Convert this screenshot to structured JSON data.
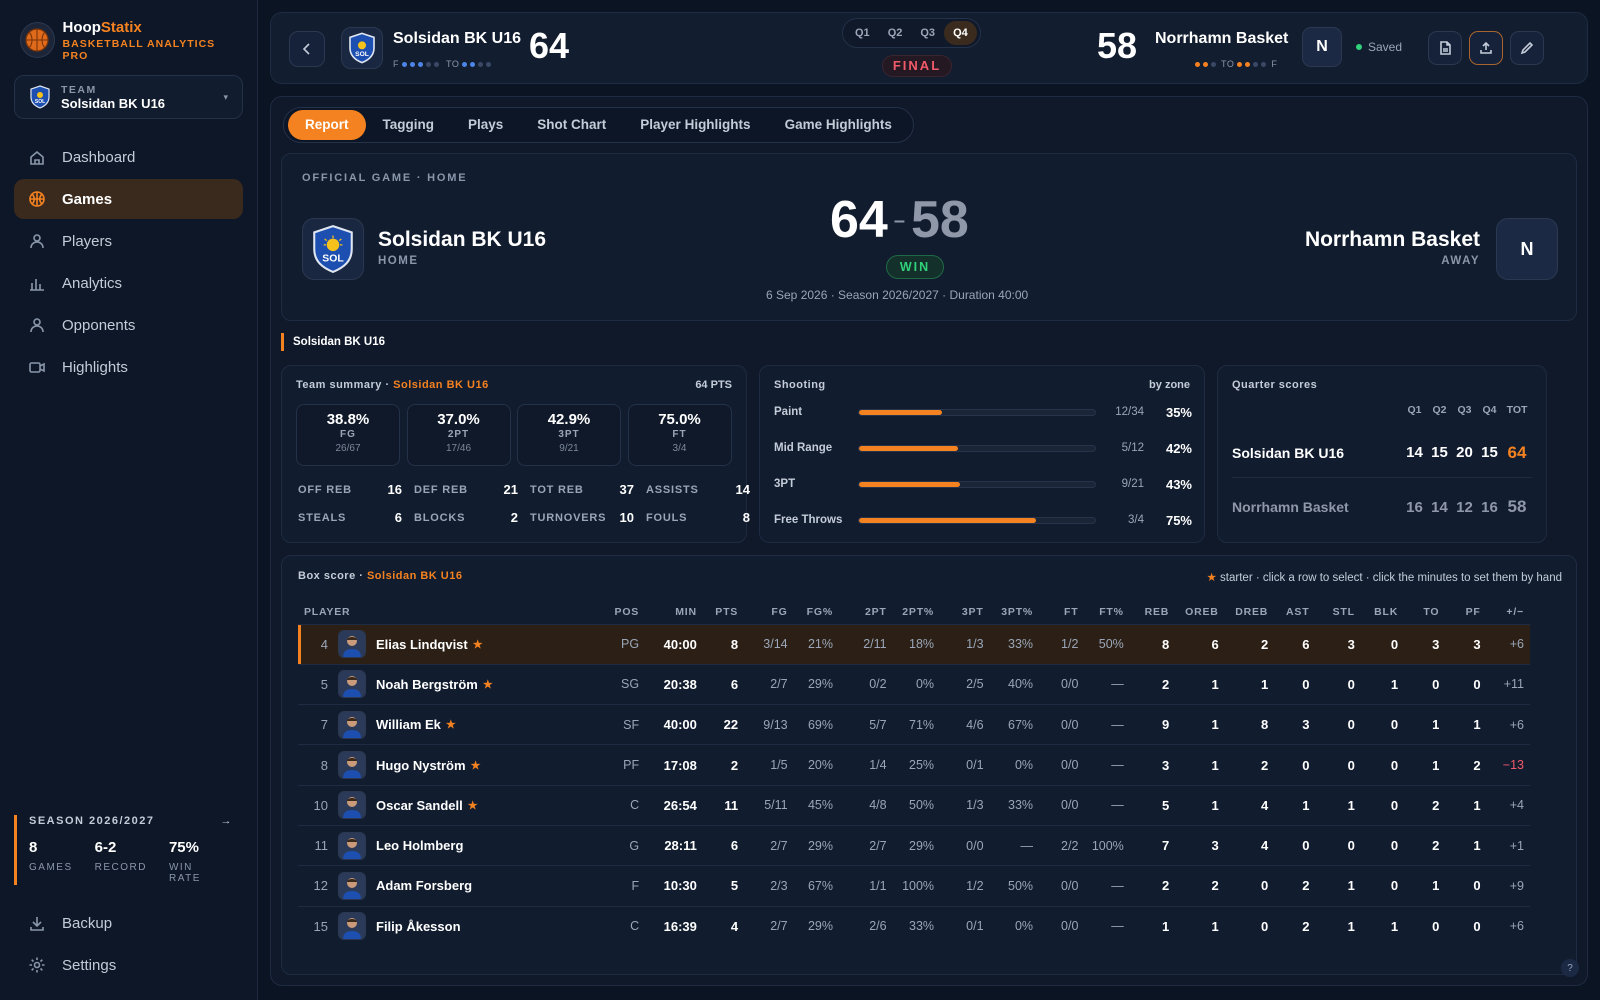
{
  "brand": {
    "name_a": "Hoop",
    "name_b": "Statix",
    "subtitle": "BASKETBALL ANALYTICS PRO"
  },
  "team_selector": {
    "label": "TEAM",
    "value": "Solsidan BK U16"
  },
  "nav": [
    {
      "label": "Dashboard",
      "icon": "home-icon"
    },
    {
      "label": "Games",
      "icon": "basketball-icon",
      "active": true
    },
    {
      "label": "Players",
      "icon": "user-icon"
    },
    {
      "label": "Analytics",
      "icon": "bar-chart-icon"
    },
    {
      "label": "Opponents",
      "icon": "user-icon"
    },
    {
      "label": "Highlights",
      "icon": "video-icon"
    }
  ],
  "season": {
    "label": "SEASON 2026/2027",
    "games": "8",
    "games_label": "GAMES",
    "record": "6-2",
    "record_label": "RECORD",
    "winrate": "75%",
    "winrate_label": "WIN RATE"
  },
  "bottom_nav": [
    {
      "label": "Backup",
      "icon": "download-icon"
    },
    {
      "label": "Settings",
      "icon": "gear-icon"
    }
  ],
  "topbar": {
    "home_team": "Solsidan BK U16",
    "home_score": "64",
    "home_f": "F",
    "home_to": "TO",
    "away_team": "Norrhamn Basket",
    "away_score": "58",
    "away_to": "TO",
    "away_f": "F",
    "away_initial": "N",
    "quarters": [
      "Q1",
      "Q2",
      "Q3",
      "Q4"
    ],
    "active_quarter": "Q4",
    "status": "FINAL",
    "saved": "Saved"
  },
  "tabs": [
    "Report",
    "Tagging",
    "Plays",
    "Shot Chart",
    "Player Highlights",
    "Game Highlights"
  ],
  "game": {
    "label": "OFFICIAL GAME · HOME",
    "home": "Solsidan BK U16",
    "home_sub": "HOME",
    "away": "Norrhamn Basket",
    "away_sub": "AWAY",
    "away_initial": "N",
    "home_score": "64",
    "away_score": "58",
    "dash": "–",
    "result": "WIN",
    "meta": "6 Sep 2026   ·   Season 2026/2027   ·   Duration 40:00"
  },
  "section_title": "Solsidan BK U16",
  "team_summary": {
    "title": "Team summary · ",
    "team": "Solsidan BK U16",
    "pts": "64 PTS",
    "pcts": [
      {
        "v": "38.8%",
        "k": "FG",
        "m": "26/67"
      },
      {
        "v": "37.0%",
        "k": "2PT",
        "m": "17/46"
      },
      {
        "v": "42.9%",
        "k": "3PT",
        "m": "9/21"
      },
      {
        "v": "75.0%",
        "k": "FT",
        "m": "3/4"
      }
    ],
    "stats": [
      {
        "k": "OFF REB",
        "v": "16"
      },
      {
        "k": "DEF REB",
        "v": "21"
      },
      {
        "k": "TOT REB",
        "v": "37"
      },
      {
        "k": "ASSISTS",
        "v": "14"
      },
      {
        "k": "STEALS",
        "v": "6"
      },
      {
        "k": "BLOCKS",
        "v": "2"
      },
      {
        "k": "TURNOVERS",
        "v": "10"
      },
      {
        "k": "FOULS",
        "v": "8"
      }
    ]
  },
  "shooting": {
    "title": "Shooting",
    "subtitle": "by zone",
    "rows": [
      {
        "zone": "Paint",
        "made": "12/34",
        "pct": "35%",
        "frac": 0.35
      },
      {
        "zone": "Mid Range",
        "made": "5/12",
        "pct": "42%",
        "frac": 0.42
      },
      {
        "zone": "3PT",
        "made": "9/21",
        "pct": "43%",
        "frac": 0.43
      },
      {
        "zone": "Free Throws",
        "made": "3/4",
        "pct": "75%",
        "frac": 0.75
      }
    ]
  },
  "quarters": {
    "title": "Quarter scores",
    "headers": [
      "Q1",
      "Q2",
      "Q3",
      "Q4",
      "TOT"
    ],
    "rows": [
      {
        "team": "Solsidan BK U16",
        "q": [
          "14",
          "15",
          "20",
          "15"
        ],
        "tot": "64"
      },
      {
        "team": "Norrhamn Basket",
        "q": [
          "16",
          "14",
          "12",
          "16"
        ],
        "tot": "58"
      }
    ]
  },
  "box": {
    "title": "Box score · ",
    "team": "Solsidan BK U16",
    "hint_star": "★",
    "hint": " starter · click a row to select · click the minutes to set them by hand",
    "columns": [
      "PLAYER",
      "POS",
      "MIN",
      "PTS",
      "FG",
      "FG%",
      "2PT",
      "2PT%",
      "3PT",
      "3PT%",
      "FT",
      "FT%",
      "REB",
      "OREB",
      "DREB",
      "AST",
      "STL",
      "BLK",
      "TO",
      "PF",
      "+/−"
    ],
    "players": [
      {
        "no": "4",
        "name": "Elias Lindqvist",
        "starter": true,
        "pos": "PG",
        "min": "40:00",
        "pts": "8",
        "fg": "3/14",
        "fgp": "21%",
        "p2": "2/11",
        "p2p": "18%",
        "p3": "1/3",
        "p3p": "33%",
        "ft": "1/2",
        "ftp": "50%",
        "reb": "8",
        "oreb": "6",
        "dreb": "2",
        "ast": "6",
        "stl": "3",
        "blk": "0",
        "to": "3",
        "pf": "3",
        "pm": "+6",
        "selected": true
      },
      {
        "no": "5",
        "name": "Noah Bergström",
        "starter": true,
        "pos": "SG",
        "min": "20:38",
        "pts": "6",
        "fg": "2/7",
        "fgp": "29%",
        "p2": "0/2",
        "p2p": "0%",
        "p3": "2/5",
        "p3p": "40%",
        "ft": "0/0",
        "ftp": "—",
        "reb": "2",
        "oreb": "1",
        "dreb": "1",
        "ast": "0",
        "stl": "0",
        "blk": "1",
        "to": "0",
        "pf": "0",
        "pm": "+11"
      },
      {
        "no": "7",
        "name": "William Ek",
        "starter": true,
        "pos": "SF",
        "min": "40:00",
        "pts": "22",
        "fg": "9/13",
        "fgp": "69%",
        "p2": "5/7",
        "p2p": "71%",
        "p3": "4/6",
        "p3p": "67%",
        "ft": "0/0",
        "ftp": "—",
        "reb": "9",
        "oreb": "1",
        "dreb": "8",
        "ast": "3",
        "stl": "0",
        "blk": "0",
        "to": "1",
        "pf": "1",
        "pm": "+6"
      },
      {
        "no": "8",
        "name": "Hugo Nyström",
        "starter": true,
        "pos": "PF",
        "min": "17:08",
        "pts": "2",
        "fg": "1/5",
        "fgp": "20%",
        "p2": "1/4",
        "p2p": "25%",
        "p3": "0/1",
        "p3p": "0%",
        "ft": "0/0",
        "ftp": "—",
        "reb": "3",
        "oreb": "1",
        "dreb": "2",
        "ast": "0",
        "stl": "0",
        "blk": "0",
        "to": "1",
        "pf": "2",
        "pm": "−13"
      },
      {
        "no": "10",
        "name": "Oscar Sandell",
        "starter": true,
        "pos": "C",
        "min": "26:54",
        "pts": "11",
        "fg": "5/11",
        "fgp": "45%",
        "p2": "4/8",
        "p2p": "50%",
        "p3": "1/3",
        "p3p": "33%",
        "ft": "0/0",
        "ftp": "—",
        "reb": "5",
        "oreb": "1",
        "dreb": "4",
        "ast": "1",
        "stl": "1",
        "blk": "0",
        "to": "2",
        "pf": "1",
        "pm": "+4"
      },
      {
        "no": "11",
        "name": "Leo Holmberg",
        "starter": false,
        "pos": "G",
        "min": "28:11",
        "pts": "6",
        "fg": "2/7",
        "fgp": "29%",
        "p2": "2/7",
        "p2p": "29%",
        "p3": "0/0",
        "p3p": "—",
        "ft": "2/2",
        "ftp": "100%",
        "reb": "7",
        "oreb": "3",
        "dreb": "4",
        "ast": "0",
        "stl": "0",
        "blk": "0",
        "to": "2",
        "pf": "1",
        "pm": "+1"
      },
      {
        "no": "12",
        "name": "Adam Forsberg",
        "starter": false,
        "pos": "F",
        "min": "10:30",
        "pts": "5",
        "fg": "2/3",
        "fgp": "67%",
        "p2": "1/1",
        "p2p": "100%",
        "p3": "1/2",
        "p3p": "50%",
        "ft": "0/0",
        "ftp": "—",
        "reb": "2",
        "oreb": "2",
        "dreb": "0",
        "ast": "2",
        "stl": "1",
        "blk": "0",
        "to": "1",
        "pf": "0",
        "pm": "+9"
      },
      {
        "no": "15",
        "name": "Filip Åkesson",
        "starter": false,
        "pos": "C",
        "min": "16:39",
        "pts": "4",
        "fg": "2/7",
        "fgp": "29%",
        "p2": "2/6",
        "p2p": "33%",
        "p3": "0/1",
        "p3p": "0%",
        "ft": "0/0",
        "ftp": "—",
        "reb": "1",
        "oreb": "1",
        "dreb": "0",
        "ast": "2",
        "stl": "1",
        "blk": "1",
        "to": "0",
        "pf": "0",
        "pm": "+6"
      }
    ]
  },
  "help": "?",
  "colors": {
    "accent": "#f58220",
    "win": "#2fd17a",
    "loss": "#f05a6a",
    "bg": "#0b1422"
  }
}
